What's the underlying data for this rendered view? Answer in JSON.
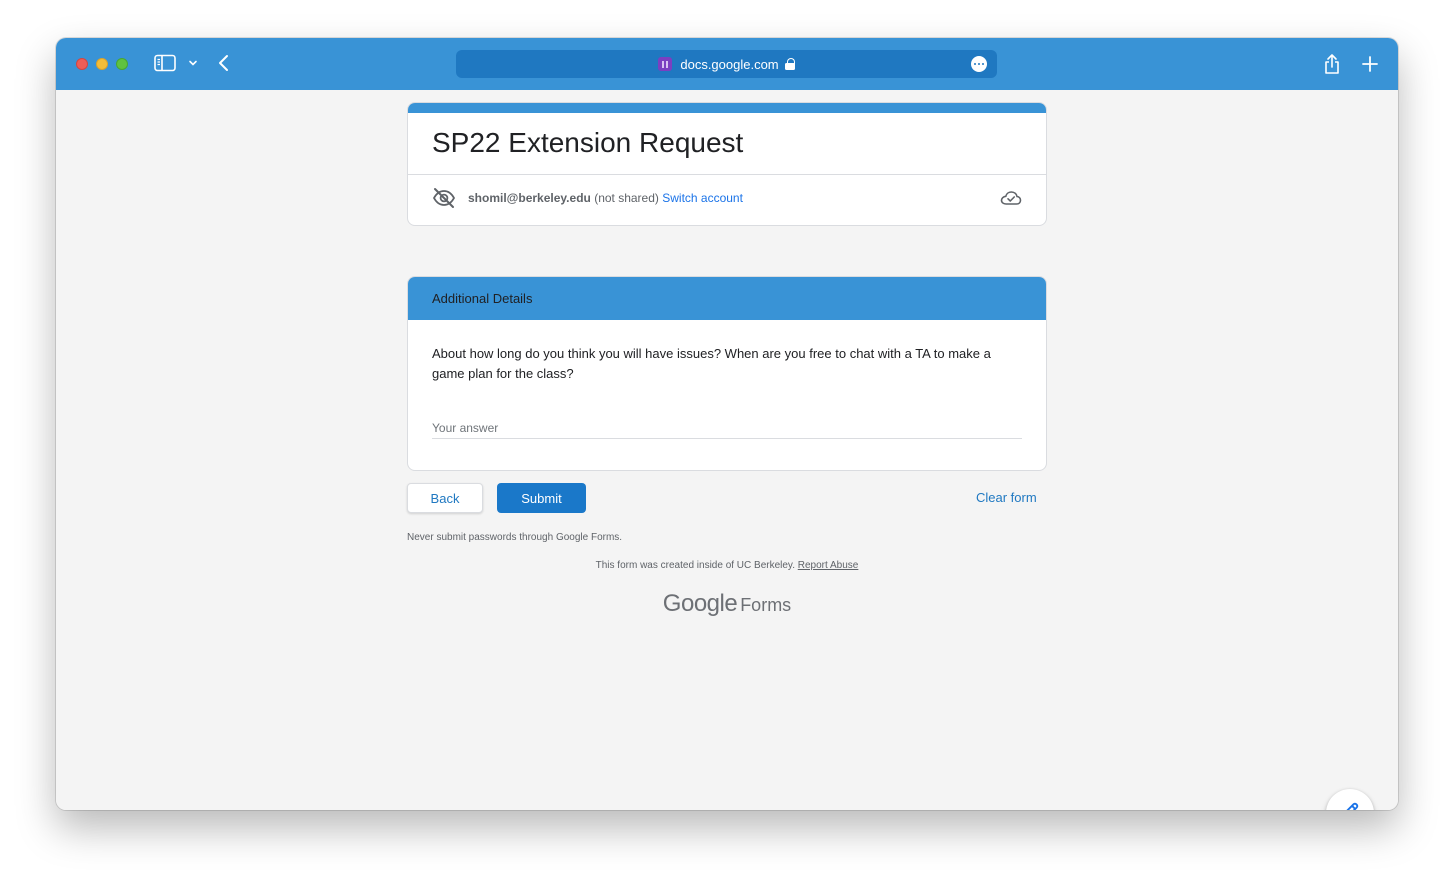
{
  "browser": {
    "url": "docs.google.com",
    "icons": [
      "sidebar-icon",
      "chevron-down-icon",
      "back-icon",
      "lock-icon",
      "more-icon",
      "share-icon",
      "plus-icon"
    ]
  },
  "form": {
    "title": "SP22 Extension Request",
    "account_email": "shomil@berkeley.edu",
    "not_shared": " (not shared) ",
    "switch_account": "Switch account",
    "section_title": "Additional Details",
    "question": "About how long do you think you will have issues? When are you free to chat with a TA to make a game plan for the class?",
    "answer_placeholder": "Your answer",
    "answer_value": ""
  },
  "actions": {
    "back": "Back",
    "submit": "Submit",
    "clear": "Clear form"
  },
  "footer": {
    "password_note": "Never submit passwords through Google Forms.",
    "created_text": "This form was created inside of UC Berkeley. ",
    "report_abuse": "Report Abuse",
    "brand_google": "Google",
    "brand_forms": "Forms"
  },
  "colors": {
    "accent": "#3993d6",
    "link": "#1a73e8",
    "submit": "#1a78c9"
  }
}
